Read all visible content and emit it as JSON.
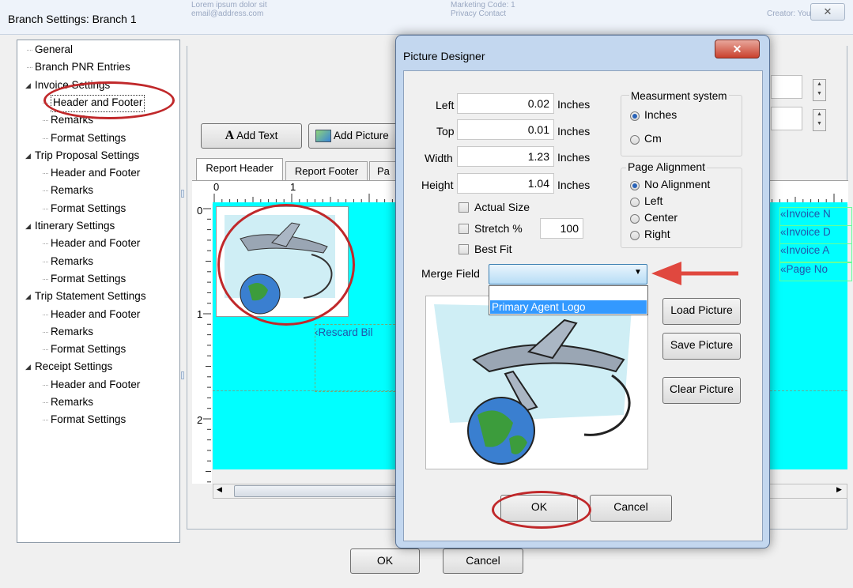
{
  "outer_window": {
    "title": "Branch Settings: Branch 1",
    "close_glyph": "✕",
    "blurred_top_texts": [
      "Lorem ipsum dolor sit",
      "email@address.com",
      "Marketing Code: 1",
      "Privacy Contact",
      "Creator: Your"
    ]
  },
  "tree": {
    "items": [
      {
        "label": "General",
        "level": 1
      },
      {
        "label": "Branch PNR Entries",
        "level": 1
      },
      {
        "label": "Invoice Settings",
        "level": 0
      },
      {
        "label": "Header and Footer",
        "level": 2,
        "selected": true
      },
      {
        "label": "Remarks",
        "level": 2
      },
      {
        "label": "Format Settings",
        "level": 2
      },
      {
        "label": "Trip Proposal Settings",
        "level": 0
      },
      {
        "label": "Header and Footer",
        "level": 2
      },
      {
        "label": "Remarks",
        "level": 2
      },
      {
        "label": "Format Settings",
        "level": 2
      },
      {
        "label": "Itinerary Settings",
        "level": 0
      },
      {
        "label": "Header and Footer",
        "level": 2
      },
      {
        "label": "Remarks",
        "level": 2
      },
      {
        "label": "Format Settings",
        "level": 2
      },
      {
        "label": "Trip Statement Settings",
        "level": 0
      },
      {
        "label": "Header and Footer",
        "level": 2
      },
      {
        "label": "Remarks",
        "level": 2
      },
      {
        "label": "Format Settings",
        "level": 2
      },
      {
        "label": "Receipt Settings",
        "level": 0
      },
      {
        "label": "Header and Footer",
        "level": 2
      },
      {
        "label": "Remarks",
        "level": 2
      },
      {
        "label": "Format Settings",
        "level": 2
      }
    ]
  },
  "toolbar": {
    "add_text_label": "Add Text",
    "add_text_icon": "A",
    "add_picture_label": "Add Picture"
  },
  "tabs": [
    {
      "label": "Report Header",
      "active": true
    },
    {
      "label": "Report Footer",
      "active": false
    },
    {
      "label": "Pa",
      "active": false
    }
  ],
  "ruler": {
    "top_marks": [
      "0",
      "1"
    ],
    "left_marks": [
      "0",
      "1",
      "2"
    ]
  },
  "canvas": {
    "bg_color": "#00ffff",
    "fields": [
      "«Rescard Bil",
      "«Invoice N",
      "«Invoice D",
      "«Invoice A",
      "«Page No"
    ]
  },
  "outer_buttons": {
    "ok": "OK",
    "cancel": "Cancel"
  },
  "dialog": {
    "title": "Picture Designer",
    "close_glyph": "✕",
    "fields": {
      "left": {
        "label": "Left",
        "value": "0.02",
        "unit": "Inches"
      },
      "top": {
        "label": "Top",
        "value": "0.01",
        "unit": "Inches"
      },
      "width": {
        "label": "Width",
        "value": "1.23",
        "unit": "Inches"
      },
      "height": {
        "label": "Height",
        "value": "1.04",
        "unit": "Inches"
      }
    },
    "measurement": {
      "title": "Measurment system",
      "options": [
        "Inches",
        "Cm"
      ],
      "selected": "Inches"
    },
    "alignment": {
      "title": "Page Alignment",
      "options": [
        "No Alignment",
        "Left",
        "Center",
        "Right"
      ],
      "selected": "No Alignment"
    },
    "checkboxes": {
      "actual_size": "Actual Size",
      "stretch": "Stretch %",
      "stretch_value": "100",
      "best_fit": "Best Fit"
    },
    "merge_field": {
      "label": "Merge Field",
      "value": "",
      "dropdown_item": "Primary Agent Logo"
    },
    "buttons": {
      "load": "Load Picture",
      "save": "Save Picture",
      "clear": "Clear Picture",
      "ok": "OK",
      "cancel": "Cancel"
    }
  },
  "colors": {
    "annotation_red": "#c0282a",
    "arrow_red": "#e0483f",
    "dropdown_highlight": "#3399ff"
  }
}
